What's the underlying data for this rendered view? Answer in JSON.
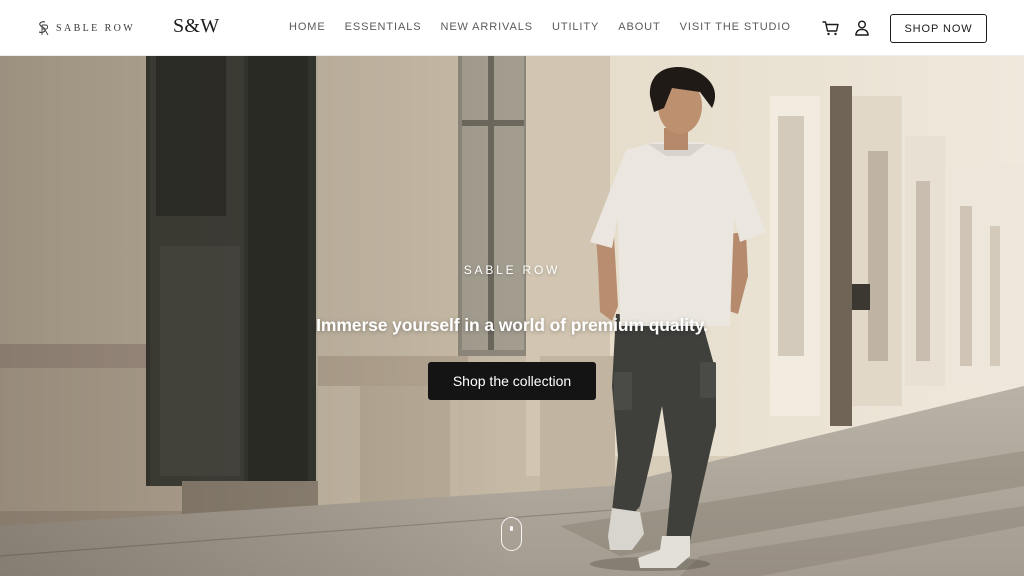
{
  "header": {
    "brand_name": "SABLE ROW",
    "monogram": "S&W",
    "nav": [
      "HOME",
      "ESSENTIALS",
      "NEW ARRIVALS",
      "UTILITY",
      "ABOUT",
      "VISIT THE STUDIO"
    ],
    "icons": {
      "cart": "cart-icon",
      "account": "user-icon"
    },
    "shop_now_label": "SHOP NOW"
  },
  "hero": {
    "eyebrow": "SABLE ROW",
    "headline": "Immerse yourself in a world of premium quality.",
    "cta_label": "Shop the collection",
    "image_subject": "man in white t-shirt and dark cargo pants walking along a sunlit stone building facade"
  },
  "colors": {
    "accent": "#141414",
    "header_bg": "#ffffff",
    "nav_text": "#5a5a5a",
    "hero_text": "#ffffff"
  }
}
